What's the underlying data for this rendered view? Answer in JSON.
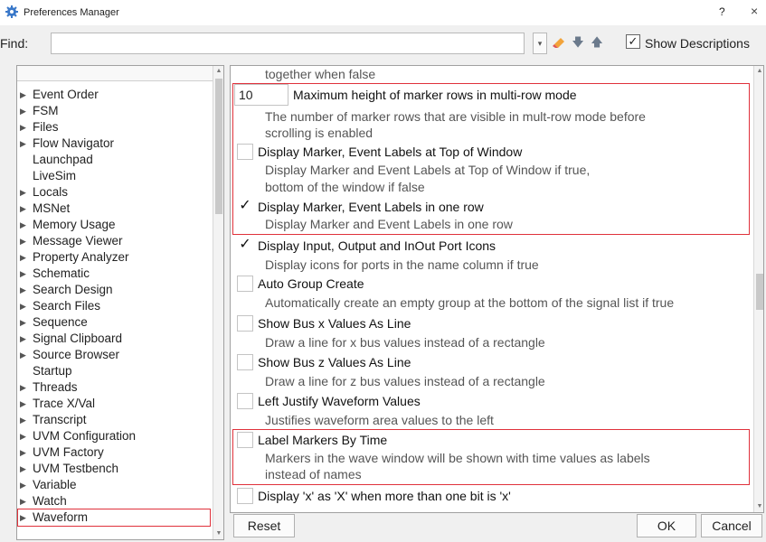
{
  "window": {
    "title": "Preferences Manager",
    "help": "?",
    "close": "×"
  },
  "find": {
    "label": "Find:",
    "value": "",
    "show_descriptions_label": "Show Descriptions",
    "show_descriptions_checked": "✓"
  },
  "categories": [
    {
      "label": "Event Order",
      "expandable": true
    },
    {
      "label": "FSM",
      "expandable": true
    },
    {
      "label": "Files",
      "expandable": true
    },
    {
      "label": "Flow Navigator",
      "expandable": true
    },
    {
      "label": "Launchpad",
      "expandable": false
    },
    {
      "label": "LiveSim",
      "expandable": false
    },
    {
      "label": "Locals",
      "expandable": true
    },
    {
      "label": "MSNet",
      "expandable": true
    },
    {
      "label": "Memory Usage",
      "expandable": true
    },
    {
      "label": "Message Viewer",
      "expandable": true
    },
    {
      "label": "Property Analyzer",
      "expandable": true
    },
    {
      "label": "Schematic",
      "expandable": true
    },
    {
      "label": "Search Design",
      "expandable": true
    },
    {
      "label": "Search Files",
      "expandable": true
    },
    {
      "label": "Sequence",
      "expandable": true
    },
    {
      "label": "Signal Clipboard",
      "expandable": true
    },
    {
      "label": "Source Browser",
      "expandable": true
    },
    {
      "label": "Startup",
      "expandable": false
    },
    {
      "label": "Threads",
      "expandable": true
    },
    {
      "label": "Trace X/Val",
      "expandable": true
    },
    {
      "label": "Transcript",
      "expandable": true
    },
    {
      "label": "UVM Configuration",
      "expandable": true
    },
    {
      "label": "UVM Factory",
      "expandable": true
    },
    {
      "label": "UVM Testbench",
      "expandable": true
    },
    {
      "label": "Variable",
      "expandable": true
    },
    {
      "label": "Watch",
      "expandable": true
    },
    {
      "label": "Waveform",
      "expandable": true,
      "selected": true
    }
  ],
  "preferences": {
    "top_desc": "together when false",
    "marker_rows": {
      "value": "10",
      "label": "Maximum height of marker rows in multi-row mode",
      "desc1": "The number of marker rows that are visible in mult-row mode before",
      "desc2": "scrolling is enabled"
    },
    "labels_top": {
      "label": "Display Marker, Event Labels at Top of Window",
      "desc1": "Display Marker and Event Labels at Top of Window if true,",
      "desc2": "bottom of the window if false",
      "checked": ""
    },
    "one_row": {
      "label": "Display Marker, Event Labels in one row",
      "desc1": "Display Marker and Event Labels in one row",
      "checked": "✓"
    },
    "port_icons": {
      "label": "Display Input, Output and InOut Port Icons",
      "desc1": "Display icons for ports in the name column if true",
      "checked": "✓"
    },
    "auto_group": {
      "label": "Auto Group Create",
      "desc1": "Automatically create an empty group at the bottom of the signal list if true",
      "checked": ""
    },
    "bus_x": {
      "label": "Show Bus x Values As Line",
      "desc1": "Draw a line for x bus values instead of a rectangle",
      "checked": ""
    },
    "bus_z": {
      "label": "Show Bus z Values As Line",
      "desc1": "Draw a line for z bus values instead of a rectangle",
      "checked": ""
    },
    "left_justify": {
      "label": "Left Justify Waveform Values",
      "desc1": "Justifies waveform area values to the left",
      "checked": ""
    },
    "label_markers": {
      "label": "Label Markers By Time",
      "desc1": "Markers in the wave window will be shown with time values as labels",
      "desc2": "instead of names",
      "checked": ""
    },
    "display_x": {
      "label": "Display 'x' as 'X' when more than one bit is 'x'",
      "checked": ""
    }
  },
  "buttons": {
    "reset": "Reset",
    "ok": "OK",
    "cancel": "Cancel"
  },
  "colors": {
    "highlight": "#e0313b"
  }
}
